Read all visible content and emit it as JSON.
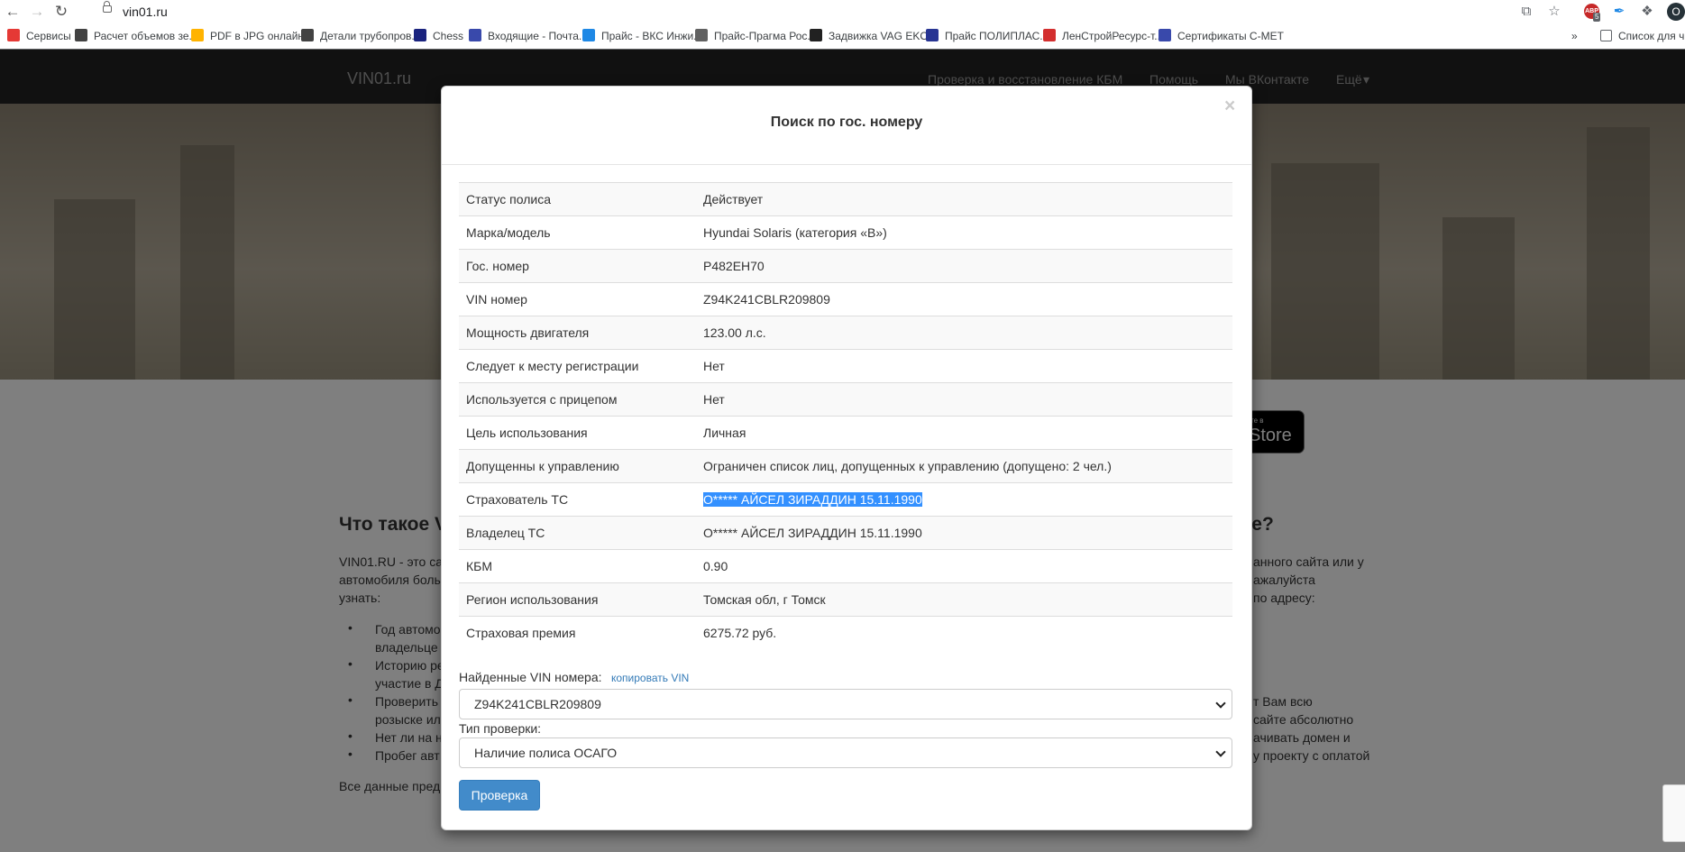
{
  "browser": {
    "url": "vin01.ru",
    "toolbar_icons": [
      "share-icon",
      "star-icon",
      "adblock-icon",
      "pen-icon",
      "puzzle-icon",
      "profile-icon"
    ],
    "adblock_badge": "ABP",
    "adblock_count": "5",
    "profile_initial": "О",
    "bookmarks": [
      {
        "label": "Сервисы",
        "icon": "apps-grid-icon",
        "color": "#e53935"
      },
      {
        "label": "Расчет объемов зе...",
        "icon": "globe-icon",
        "color": "#424242"
      },
      {
        "label": "PDF в JPG онлайн...",
        "icon": "pdf-icon",
        "color": "#ffb300"
      },
      {
        "label": "Детали трубопров...",
        "icon": "globe-icon",
        "color": "#424242"
      },
      {
        "label": "Chess",
        "icon": "chess-icon",
        "color": "#1a237e"
      },
      {
        "label": "Входящие - Почта...",
        "icon": "mail-icon",
        "color": "#3949ab"
      },
      {
        "label": "Прайс - ВКС Инжи...",
        "icon": "drop-icon",
        "color": "#1e88e5"
      },
      {
        "label": "Прайс-Прагма Рос...",
        "icon": "chart-icon",
        "color": "#616161"
      },
      {
        "label": "Задвижка VAG EKO...",
        "icon": "valve-icon",
        "color": "#212121"
      },
      {
        "label": "Прайс ПОЛИПЛАС...",
        "icon": "polyplast-icon",
        "color": "#283593"
      },
      {
        "label": "ЛенСтройРесурс-т...",
        "icon": "red-circle-icon",
        "color": "#d32f2f"
      },
      {
        "label": "Сертификаты С-МЕТ",
        "icon": "smet-icon",
        "color": "#3949ab"
      }
    ],
    "bookmarks_overflow": "»",
    "reading_list": "Список для ч"
  },
  "site": {
    "brand": "VIN01.ru",
    "nav": [
      "Проверка и восстановление КБМ",
      "Помощь",
      "Мы ВКонтакте",
      "Ещё"
    ],
    "appstore_small": "те в",
    "appstore_big": "Store",
    "left_heading": "Что такое V",
    "right_heading": "те?",
    "left_para": [
      "VIN01.RU - это са",
      "автомобиля боль",
      "узнать:"
    ],
    "left_bullets": [
      "Год автомо",
      "владельце",
      "Историю ре",
      "участие в Д",
      "Проверить",
      "розыске ил",
      "Нет ли на н",
      "Пробег авт"
    ],
    "left_footer": "Все данные пред",
    "right_para1": [
      "анного сайта или у",
      "ажалуйста",
      "по адресу:"
    ],
    "right_para2": [
      "т Вам всю",
      "сайте абсолютно",
      "ачивать домен и",
      "у проекту с оплатой"
    ]
  },
  "modal": {
    "title": "Поиск по гос. номеру",
    "close": "×",
    "rows": [
      {
        "label": "Статус полиса",
        "value": "Действует"
      },
      {
        "label": "Марка/модель",
        "value": "Hyundai Solaris (категория «B»)"
      },
      {
        "label": "Гос. номер",
        "value": "Р482ЕН70"
      },
      {
        "label": "VIN номер",
        "value": "Z94K241CBLR209809"
      },
      {
        "label": "Мощность двигателя",
        "value": "123.00 л.с."
      },
      {
        "label": "Следует к месту регистрации",
        "value": "Нет"
      },
      {
        "label": "Используется с прицепом",
        "value": "Нет"
      },
      {
        "label": "Цель использования",
        "value": "Личная"
      },
      {
        "label": "Допущенны к управлению",
        "value": "Ограничен список лиц, допущенных к управлению (допущено: 2 чел.)"
      },
      {
        "label": "Страхователь ТС",
        "value": "О***** АЙСЕЛ ЗИРАДДИН 15.11.1990"
      },
      {
        "label": "Владелец ТС",
        "value": "О***** АЙСЕЛ ЗИРАДДИН 15.11.1990"
      },
      {
        "label": "КБМ",
        "value": "0.90"
      },
      {
        "label": "Регион использования",
        "value": "Томская обл, г Томск"
      },
      {
        "label": "Страховая премия",
        "value": "6275.72 руб."
      }
    ],
    "vin_label": "Найденные VIN номера:",
    "copy_vin": "копировать VIN",
    "vin_select_value": "Z94K241CBLR209809",
    "check_type_label": "Тип проверки:",
    "check_type_value": "Наличие полиса ОСАГО",
    "submit": "Проверка"
  }
}
